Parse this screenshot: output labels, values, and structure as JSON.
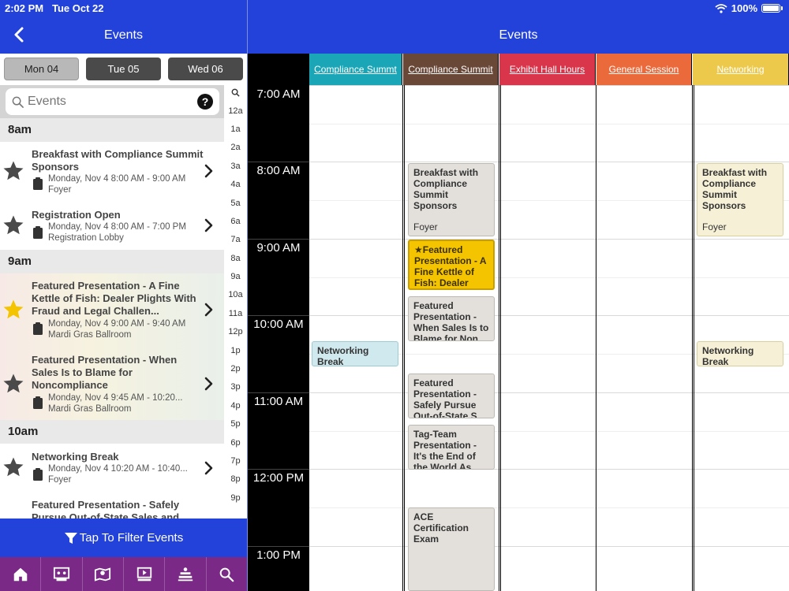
{
  "status": {
    "time": "2:02 PM",
    "date": "Tue Oct 22",
    "battery": "100%"
  },
  "left": {
    "title": "Events",
    "days": [
      "Mon 04",
      "Tue 05",
      "Wed 06"
    ],
    "search_placeholder": "Events",
    "help": "?",
    "index": [
      "12a",
      "1a",
      "2a",
      "3a",
      "4a",
      "5a",
      "6a",
      "7a",
      "8a",
      "9a",
      "10a",
      "11a",
      "12p",
      "1p",
      "2p",
      "3p",
      "4p",
      "5p",
      "6p",
      "7p",
      "8p",
      "9p"
    ],
    "hours": [
      "8am",
      "9am",
      "10am"
    ],
    "events": [
      {
        "title": "Breakfast with Compliance Summit Sponsors",
        "time": "Monday, Nov 4 8:00 AM - 9:00 AM",
        "location": "Foyer",
        "featured": false
      },
      {
        "title": "Registration Open",
        "time": "Monday, Nov 4 8:00 AM - 7:00 PM",
        "location": "Registration Lobby",
        "featured": false
      },
      {
        "title": "Featured Presentation - A Fine Kettle of Fish: Dealer Plights With Fraud and Legal Challen...",
        "time": "Monday, Nov 4 9:00 AM - 9:40 AM",
        "location": "Mardi Gras Ballroom",
        "featured": true
      },
      {
        "title": "Featured Presentation - When Sales Is to Blame for Noncompliance",
        "time": "Monday, Nov 4 9:45 AM - 10:20...",
        "location": "Mardi Gras Ballroom",
        "featured": false
      },
      {
        "title": "Networking Break",
        "time": "Monday, Nov 4 10:20 AM - 10:40...",
        "location": "Foyer",
        "featured": false
      },
      {
        "title": "Featured Presentation - Safely Pursue Out-of-State Sales and",
        "time": "",
        "location": "",
        "featured": false
      }
    ],
    "filter_label": "Tap To Filter Events",
    "bottom_nav": [
      "home-icon",
      "sessions-icon",
      "map-icon",
      "media-icon",
      "agenda-icon",
      "search-icon"
    ]
  },
  "right": {
    "title": "Events",
    "times": [
      "7:00 AM",
      "8:00 AM",
      "9:00 AM",
      "10:00 AM",
      "11:00 AM",
      "12:00 PM",
      "1:00 PM"
    ],
    "tracks": [
      {
        "name": "Compliance Summt",
        "bg": "#1aa6b7",
        "color": "#ffffff"
      },
      {
        "name": "Compliance Summit",
        "bg": "#6a4838",
        "color": "#ffffff"
      },
      {
        "name": "Exhibit Hall Hours",
        "bg": "#d9354b",
        "color": "#ffffff"
      },
      {
        "name": "General Session",
        "bg": "#ea6a3c",
        "color": "#ffffff"
      },
      {
        "name": "Networking",
        "bg": "#ecc94b",
        "color": "#ffffff"
      }
    ],
    "boxes": [
      {
        "track": 1,
        "title": "Breakfast with Compliance Summit Sponsors",
        "location": "Foyer",
        "style": "gray"
      },
      {
        "track": 1,
        "title": "★Featured Presentation - A Fine Kettle of Fish: Dealer Pli...",
        "location": "",
        "style": "feat"
      },
      {
        "track": 1,
        "title": "Featured Presentation - When Sales Is to Blame for Non...",
        "location": "",
        "style": "gray"
      },
      {
        "track": 1,
        "title": "Featured Presentation - Safely Pursue Out-of-State S...",
        "location": "",
        "style": "gray"
      },
      {
        "track": 1,
        "title": "Tag-Team Presentation - It's the End of the World As...",
        "location": "",
        "style": "gray"
      },
      {
        "track": 1,
        "title": "ACE Certification Exam",
        "location": "",
        "style": "gray"
      },
      {
        "track": 0,
        "title": "Networking Break",
        "location": "",
        "style": "teal"
      },
      {
        "track": 4,
        "title": "Breakfast with Compliance Summit Sponsors",
        "location": "Foyer",
        "style": "cream"
      },
      {
        "track": 4,
        "title": "Networking Break",
        "location": "",
        "style": "cream"
      }
    ]
  }
}
